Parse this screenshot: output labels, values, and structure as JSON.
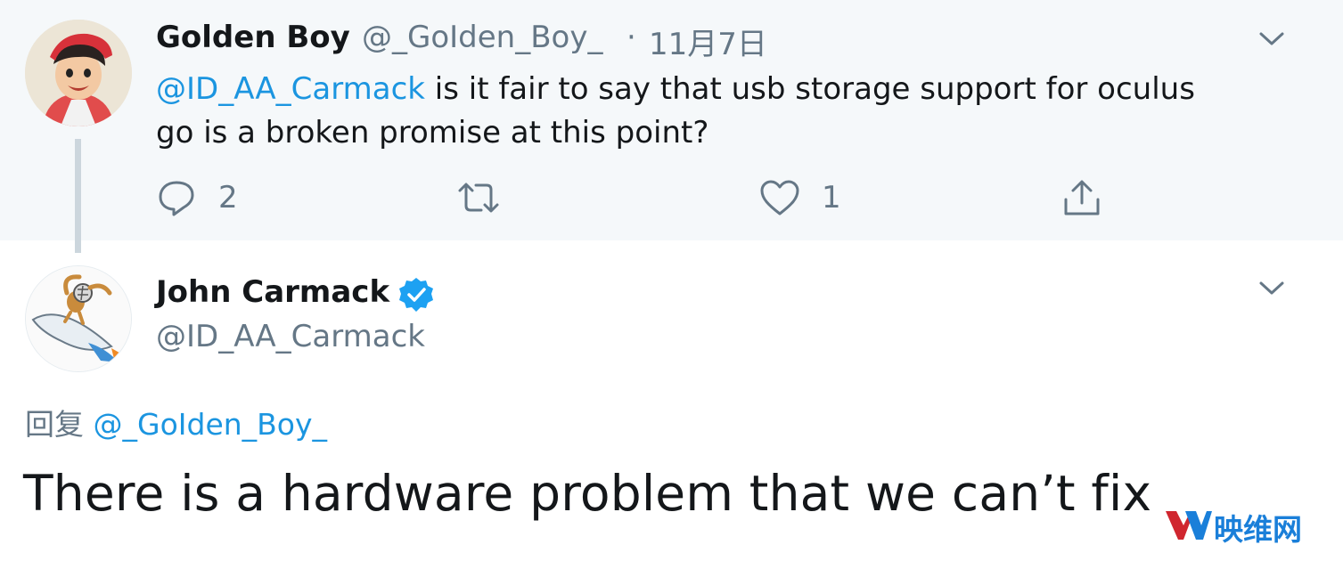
{
  "parent_tweet": {
    "display_name": "Golden Boy",
    "handle": "@_GoIden_Boy_",
    "separator": "·",
    "date": "11月7日",
    "mention": "@ID_AA_Carmack",
    "text_line1": " is it fair to say that usb storage support for oculus",
    "text_line2": "go is a broken promise at this point?",
    "reply_count": "2",
    "like_count": "1"
  },
  "reply_tweet": {
    "display_name": "John Carmack",
    "handle": "@ID_AA_Carmack",
    "reply_prefix": "回复",
    "reply_to_handle": "@_GoIden_Boy_",
    "text": "There is a hardware problem that we can’t fix"
  },
  "watermark": {
    "text": "映维网",
    "logo": "YV"
  },
  "colors": {
    "link": "#1b95e0",
    "secondary": "#657786",
    "parent_bg": "#f5f8fa",
    "verified": "#1da1f2",
    "watermark": "#1a7fd9"
  },
  "icons": [
    "reply-icon",
    "retweet-icon",
    "like-icon",
    "share-icon",
    "chevron-down-icon",
    "verified-badge-icon"
  ]
}
